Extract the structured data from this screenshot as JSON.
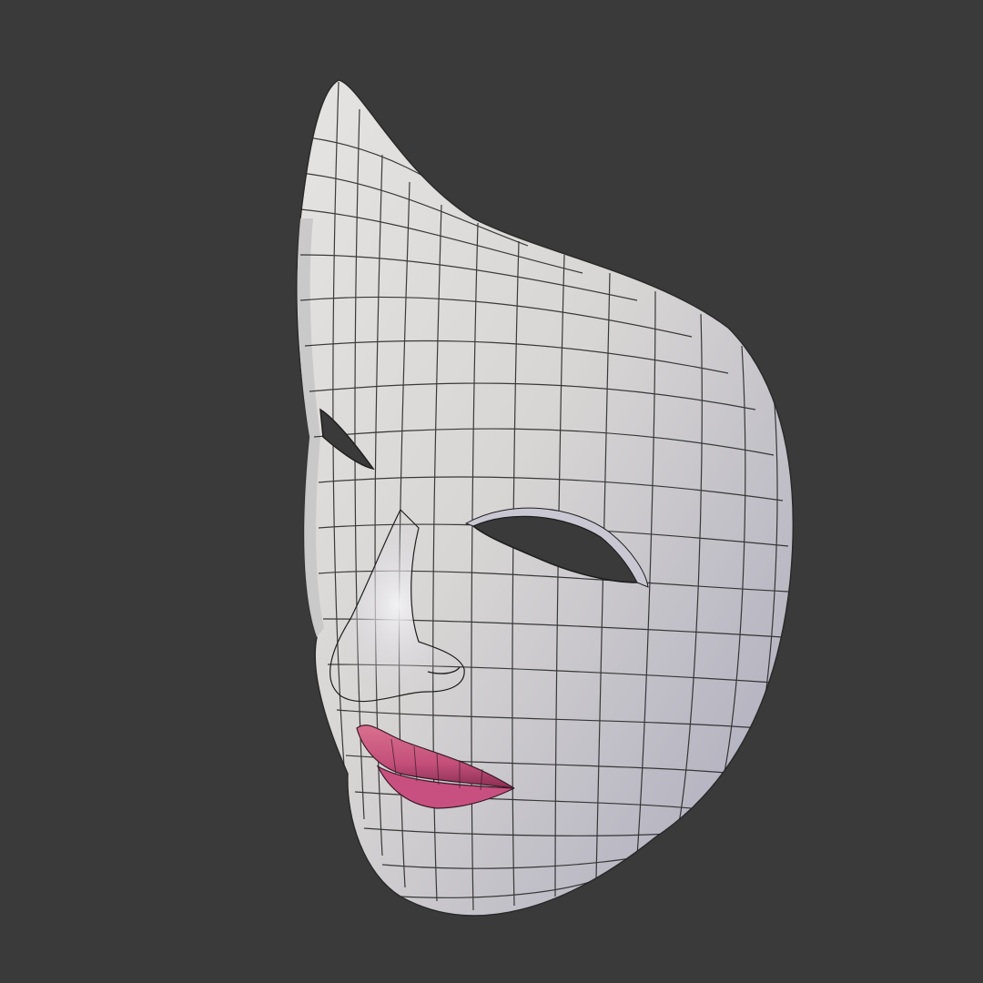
{
  "scene": {
    "background_color": "#3a3a3a",
    "object": "mask-mesh",
    "shading": "wireframe-on-shaded",
    "colors": {
      "mask_surface": "#dcdbd9",
      "mask_shadow": "#a9a8b8",
      "wire": "#1e1e1e",
      "lips": "#cc5a82",
      "lips_dark": "#8a2e52",
      "eye_hole": "#3a3a3a"
    }
  }
}
